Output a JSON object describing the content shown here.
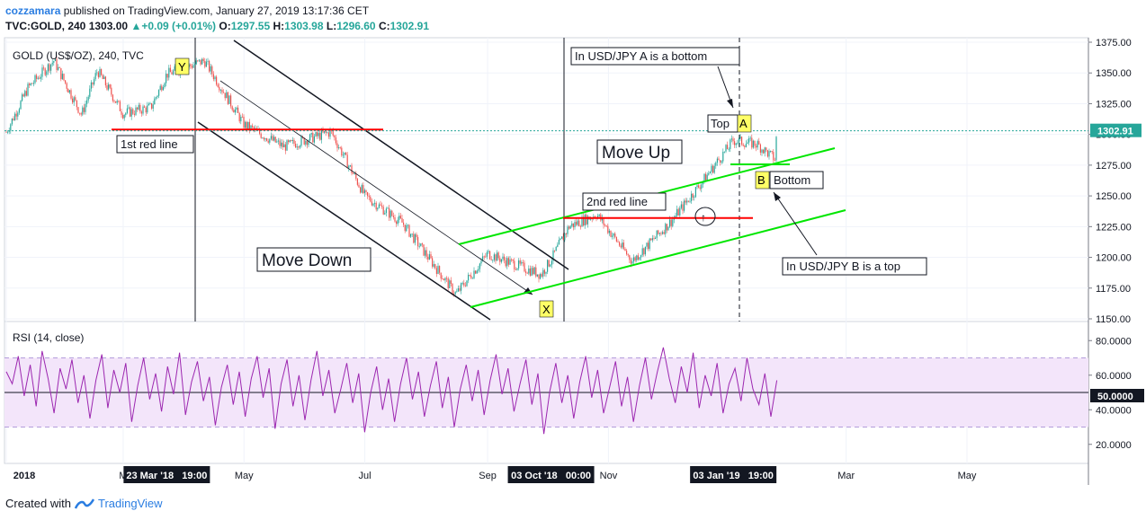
{
  "header": {
    "user": "cozzamara",
    "published": "published on TradingView.com, January 27, 2019 13:17:36 CET",
    "symbol": "TVC:GOLD, 240",
    "last": "1303.00",
    "change": "+0.09 (+0.01%)",
    "open_label": "O:",
    "open": "1297.55",
    "high_label": "H:",
    "high": "1303.98",
    "low_label": "L:",
    "low": "1296.60",
    "close_label": "C:",
    "close": "1302.91"
  },
  "footer": {
    "created_with": "Created with",
    "brand": "TradingView"
  },
  "colors": {
    "candle_up": "#26a69a",
    "candle_down": "#ef5350",
    "red_line": "#ff0000",
    "green_channel": "#00e600",
    "rsi_line": "#9c27b0",
    "rsi_band": "#f3e5fa",
    "label_yellow": "#ffff66"
  },
  "chart_data": [
    {
      "type": "candlestick",
      "title": "GOLD (US$/OZ), 240, TVC",
      "last_price_label": "1302.91",
      "y_ticks": [
        "1375.00",
        "1350.00",
        "1325.00",
        "1300.00",
        "1275.00",
        "1250.00",
        "1225.00",
        "1200.00",
        "1175.00",
        "1150.00"
      ],
      "ylim": [
        1150,
        1375
      ],
      "x_ticks": [
        "2018",
        "M",
        "May",
        "Jul",
        "Sep",
        "Nov",
        "Mar",
        "May"
      ],
      "x_highlights": [
        "23 Mar '18   19:00",
        "03 Oct '18   00:00",
        "03 Jan '19   19:00"
      ],
      "close_path": [
        {
          "date": "2018-01-01",
          "close": 1302
        },
        {
          "date": "2018-01-12",
          "close": 1338
        },
        {
          "date": "2018-01-25",
          "close": 1360
        },
        {
          "date": "2018-02-08",
          "close": 1316
        },
        {
          "date": "2018-02-16",
          "close": 1352
        },
        {
          "date": "2018-03-01",
          "close": 1317
        },
        {
          "date": "2018-03-15",
          "close": 1322
        },
        {
          "date": "2018-03-23",
          "close": 1349
        },
        {
          "date": "2018-04-11",
          "close": 1360
        },
        {
          "date": "2018-05-01",
          "close": 1308
        },
        {
          "date": "2018-05-21",
          "close": 1290
        },
        {
          "date": "2018-06-14",
          "close": 1302
        },
        {
          "date": "2018-07-01",
          "close": 1250
        },
        {
          "date": "2018-07-20",
          "close": 1228
        },
        {
          "date": "2018-08-16",
          "close": 1170
        },
        {
          "date": "2018-09-01",
          "close": 1203
        },
        {
          "date": "2018-09-28",
          "close": 1186
        },
        {
          "date": "2018-10-03",
          "close": 1198
        },
        {
          "date": "2018-10-12",
          "close": 1225
        },
        {
          "date": "2018-10-26",
          "close": 1235
        },
        {
          "date": "2018-11-13",
          "close": 1197
        },
        {
          "date": "2018-12-03",
          "close": 1230
        },
        {
          "date": "2018-12-20",
          "close": 1265
        },
        {
          "date": "2019-01-03",
          "close": 1295
        },
        {
          "date": "2019-01-15",
          "close": 1292
        },
        {
          "date": "2019-01-24",
          "close": 1280
        },
        {
          "date": "2019-01-25",
          "close": 1303
        }
      ],
      "drawings": {
        "red_lines": [
          {
            "label": "1st red line",
            "price": 1304
          },
          {
            "label": "2nd red line",
            "price": 1232
          }
        ],
        "labels": [
          {
            "text": "Move Down"
          },
          {
            "text": "Move Up"
          },
          {
            "text": "In USD/JPY A is a bottom"
          },
          {
            "text": "In USD/JPY B is a top"
          },
          {
            "text": "Top"
          },
          {
            "text": "Bottom"
          }
        ],
        "markers": [
          "Y",
          "X",
          "A",
          "B"
        ]
      }
    },
    {
      "type": "line",
      "title": "RSI (14, close)",
      "y_ticks": [
        "80.0000",
        "60.0000",
        "40.0000",
        "20.0000"
      ],
      "ylim": [
        10,
        90
      ],
      "level_label": "50.0000",
      "band": [
        30,
        70
      ],
      "series": [
        {
          "values": [
            62,
            55,
            71,
            48,
            66,
            42,
            74,
            58,
            38,
            64,
            52,
            69,
            44,
            60,
            35,
            57,
            72,
            41,
            63,
            50,
            67,
            33,
            54,
            70,
            46,
            61,
            39,
            65,
            49,
            73,
            37,
            56,
            68,
            45,
            59,
            31,
            53,
            66,
            43,
            62,
            36,
            58,
            71,
            47,
            64,
            29,
            55,
            69,
            42,
            60,
            34,
            57,
            74,
            48,
            63,
            38,
            52,
            67,
            44,
            61,
            27,
            50,
            65,
            40,
            58,
            33,
            55,
            70,
            46,
            62,
            36,
            54,
            68,
            41,
            59,
            30,
            52,
            66,
            45,
            63,
            37,
            57,
            72,
            49,
            64,
            39,
            55,
            69,
            43,
            61,
            26,
            51,
            67,
            44,
            60,
            35,
            56,
            71,
            47,
            63,
            38,
            53,
            68,
            42,
            59,
            33,
            54,
            70,
            46,
            62,
            76,
            58,
            44,
            65,
            50,
            73,
            41,
            60,
            48,
            67,
            38,
            55,
            64,
            45,
            70,
            52,
            43,
            61,
            36,
            57
          ]
        }
      ]
    }
  ]
}
